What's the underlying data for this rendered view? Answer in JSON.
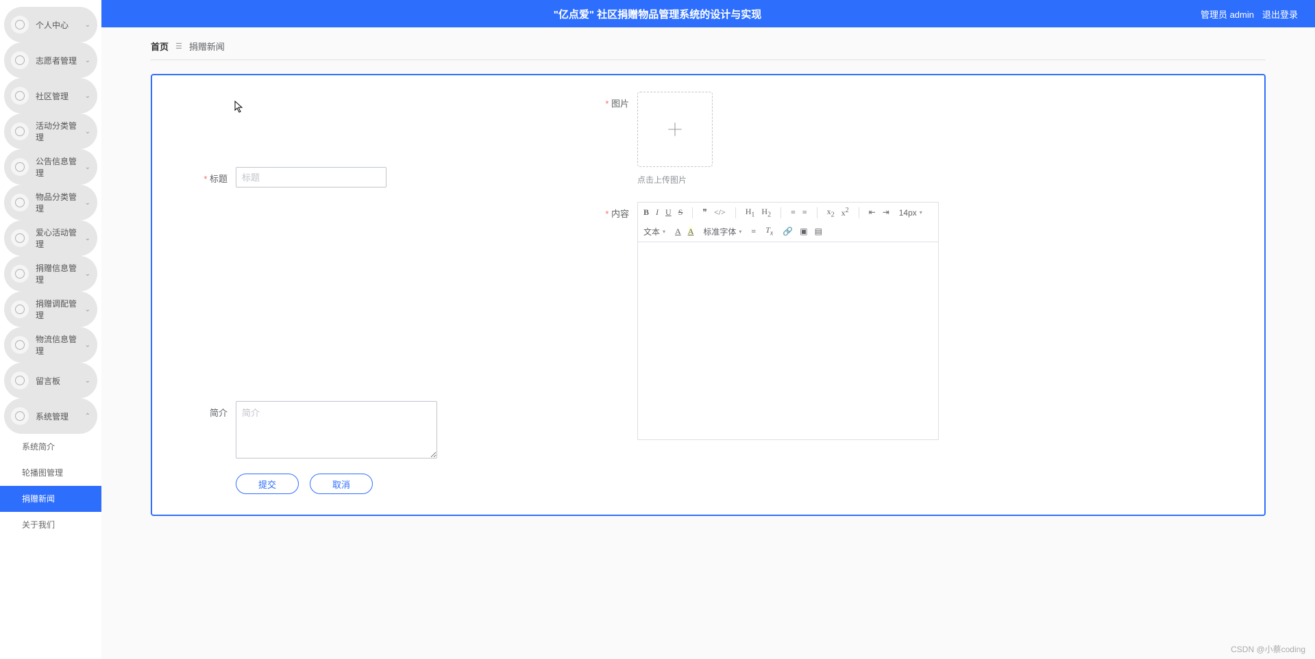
{
  "header": {
    "title": "\"亿点爱\" 社区捐赠物品管理系统的设计与实现",
    "admin_label": "管理员 admin",
    "logout": "退出登录"
  },
  "sidebar": {
    "items": [
      {
        "label": "个人中心"
      },
      {
        "label": "志愿者管理"
      },
      {
        "label": "社区管理"
      },
      {
        "label": "活动分类管理"
      },
      {
        "label": "公告信息管理"
      },
      {
        "label": "物品分类管理"
      },
      {
        "label": "爱心活动管理"
      },
      {
        "label": "捐赠信息管理"
      },
      {
        "label": "捐赠调配管理"
      },
      {
        "label": "物流信息管理"
      },
      {
        "label": "留言板"
      },
      {
        "label": "系统管理",
        "expanded": true
      }
    ],
    "subitems": [
      {
        "label": "系统简介"
      },
      {
        "label": "轮播图管理"
      },
      {
        "label": "捐赠新闻",
        "active": true
      },
      {
        "label": "关于我们"
      }
    ]
  },
  "breadcrumb": {
    "home": "首页",
    "sep_glyph": "☰",
    "current": "捐赠新闻"
  },
  "form": {
    "title_label": "标题",
    "title_placeholder": "标题",
    "intro_label": "简介",
    "intro_placeholder": "简介",
    "image_label": "图片",
    "upload_tip": "点击上传图片",
    "content_label": "内容",
    "submit": "提交",
    "cancel": "取消"
  },
  "editor": {
    "font_size": "14px",
    "text_type": "文本",
    "font_family": "标准字体"
  },
  "watermark": "CSDN @小蔡coding"
}
